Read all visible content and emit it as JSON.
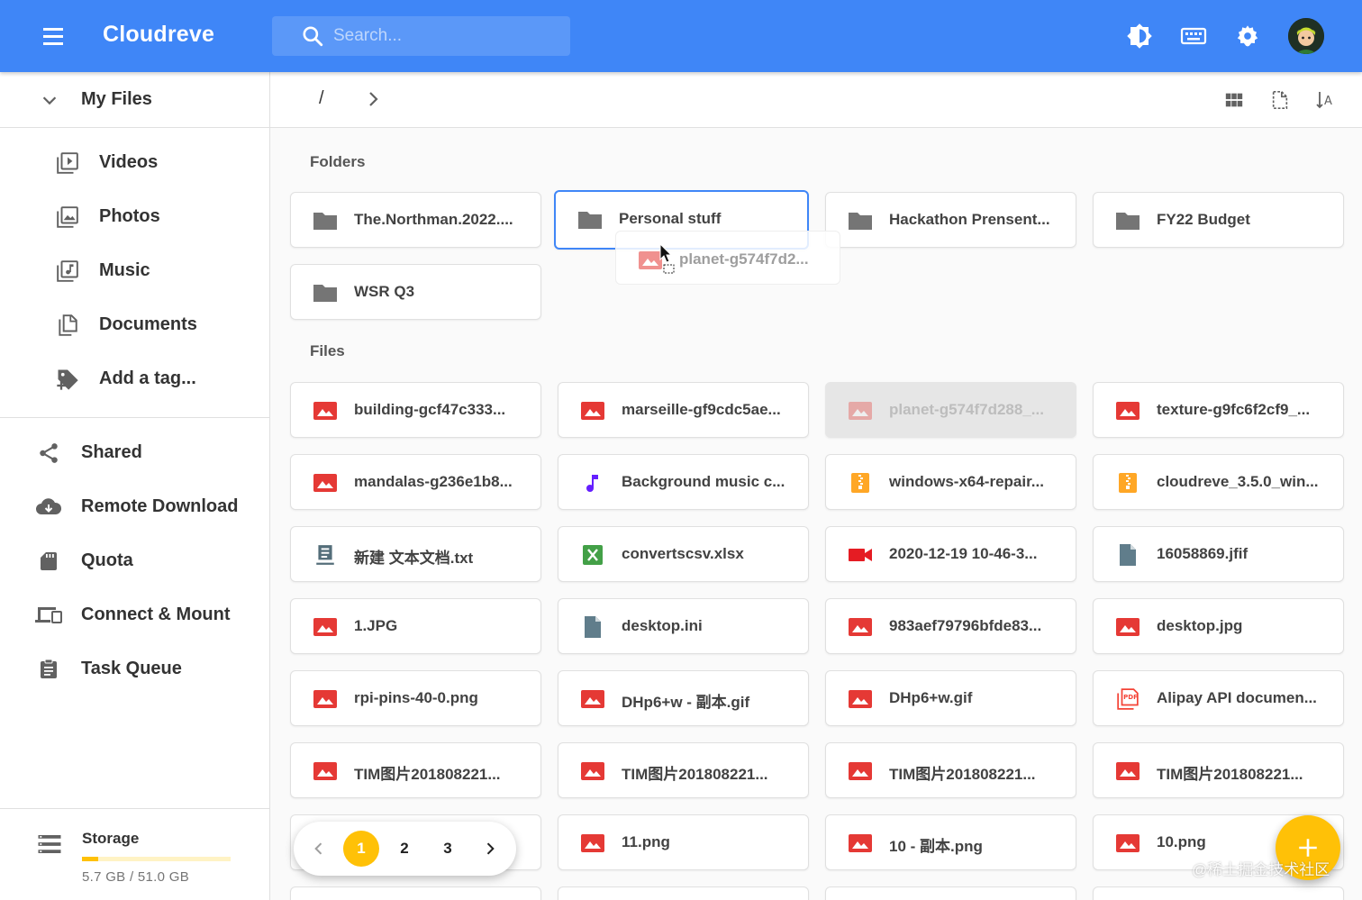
{
  "app": {
    "title": "Cloudreve"
  },
  "search": {
    "placeholder": "Search..."
  },
  "header_icons": [
    "theme-toggle-icon",
    "keyboard-icon",
    "settings-gear-icon",
    "user-avatar"
  ],
  "sidebar": {
    "my_files": "My Files",
    "sub_items": [
      {
        "label": "Videos",
        "icon": "video-library-icon"
      },
      {
        "label": "Photos",
        "icon": "photo-library-icon"
      },
      {
        "label": "Music",
        "icon": "music-library-icon"
      },
      {
        "label": "Documents",
        "icon": "documents-icon"
      },
      {
        "label": "Add a tag...",
        "icon": "add-tag-icon"
      }
    ],
    "nav_items": [
      {
        "label": "Shared",
        "icon": "share-icon"
      },
      {
        "label": "Remote Download",
        "icon": "cloud-download-icon"
      },
      {
        "label": "Quota",
        "icon": "sd-card-icon"
      },
      {
        "label": "Connect & Mount",
        "icon": "devices-icon"
      },
      {
        "label": "Task Queue",
        "icon": "clipboard-icon"
      }
    ],
    "storage": {
      "title": "Storage",
      "usage": "5.7 GB / 51.0 GB",
      "used_fraction": 0.112
    }
  },
  "breadcrumb": {
    "root": "/"
  },
  "sections": {
    "folders": "Folders",
    "files": "Files"
  },
  "folders": [
    {
      "name": "The.Northman.2022...."
    },
    {
      "name": "Personal stuff",
      "selected": true
    },
    {
      "name": "Hackathon Prensent..."
    },
    {
      "name": "FY22 Budget"
    },
    {
      "name": "WSR Q3"
    }
  ],
  "drag_ghost": {
    "name": "planet-g574f7d2..."
  },
  "files": [
    {
      "name": "building-gcf47c333...",
      "type": "image"
    },
    {
      "name": "marseille-gf9cdc5ae...",
      "type": "image"
    },
    {
      "name": "planet-g574f7d288_...",
      "type": "image",
      "dragging": true
    },
    {
      "name": "texture-g9fc6f2cf9_...",
      "type": "image"
    },
    {
      "name": "mandalas-g236e1b8...",
      "type": "image"
    },
    {
      "name": "Background music c...",
      "type": "audio"
    },
    {
      "name": "windows-x64-repair...",
      "type": "archive"
    },
    {
      "name": "cloudreve_3.5.0_win...",
      "type": "archive"
    },
    {
      "name": "新建 文本文档.txt",
      "type": "text"
    },
    {
      "name": "convertscsv.xlsx",
      "type": "excel"
    },
    {
      "name": "2020-12-19 10-46-3...",
      "type": "video"
    },
    {
      "name": "16058869.jfif",
      "type": "file"
    },
    {
      "name": "1.JPG",
      "type": "image"
    },
    {
      "name": "desktop.ini",
      "type": "file"
    },
    {
      "name": "983aef79796bfde83...",
      "type": "image"
    },
    {
      "name": "desktop.jpg",
      "type": "image"
    },
    {
      "name": "rpi-pins-40-0.png",
      "type": "image"
    },
    {
      "name": "DHp6+w - 副本.gif",
      "type": "image"
    },
    {
      "name": "DHp6+w.gif",
      "type": "image"
    },
    {
      "name": "Alipay API documen...",
      "type": "pdf"
    },
    {
      "name": "TIM图片201808221...",
      "type": "image"
    },
    {
      "name": "TIM图片201808221...",
      "type": "image"
    },
    {
      "name": "TIM图片201808221...",
      "type": "image"
    },
    {
      "name": "TIM图片201808221...",
      "type": "image"
    },
    {
      "name": "",
      "type": "hidden"
    },
    {
      "name": "11.png",
      "type": "image"
    },
    {
      "name": "10 - 副本.png",
      "type": "image"
    },
    {
      "name": "10.png",
      "type": "image"
    }
  ],
  "pagination": {
    "pages": [
      "1",
      "2",
      "3"
    ],
    "current": "1"
  },
  "watermark": "@稀土掘金技术社区",
  "colors": {
    "primary": "#3f86f7",
    "accent": "#ffc107",
    "image_red": "#e53935",
    "audio_purple": "#651fff",
    "archive_orange": "#ffa726",
    "excel_green": "#43a047",
    "video_red": "#e51c23",
    "file_blue_grey": "#607d8b",
    "text_blue_grey": "#546e7a",
    "pdf_red": "#f44336"
  }
}
